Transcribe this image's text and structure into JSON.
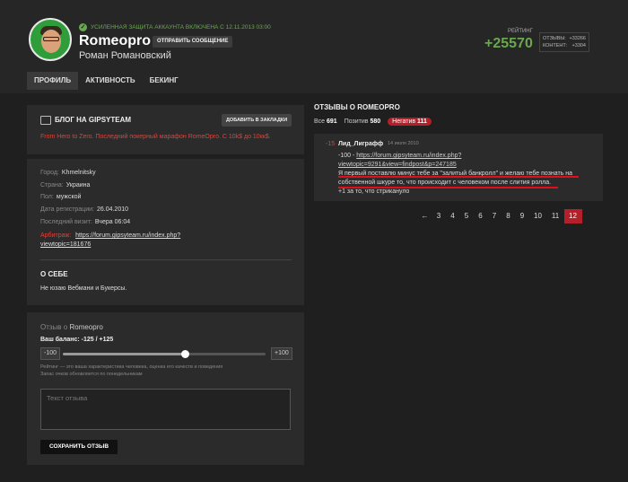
{
  "header": {
    "verify_text": "УСИЛЕННАЯ ЗАЩИТА АККАУНТА ВКЛЮЧЕНА С 12.11.2013 03:00",
    "nickname": "Romeopro",
    "send_message": "ОТПРАВИТЬ СООБЩЕНИЕ",
    "full_name": "Роман Романовский",
    "rating_label": "РЕЙТИНГ",
    "rating_value": "+25570",
    "reviews_label": "ОТЗЫВЫ:",
    "reviews_value": "+33266",
    "content_label": "КОНТЕНТ:",
    "content_value": "+3304"
  },
  "tabs": [
    {
      "label": "ПРОФИЛЬ",
      "active": true
    },
    {
      "label": "АКТИВНОСТЬ",
      "active": false
    },
    {
      "label": "БЕКИНГ",
      "active": false
    }
  ],
  "blog": {
    "title": "БЛОГ НА GIPSYTEAM",
    "bookmark": "ДОБАВИТЬ В ЗАКЛАДКИ",
    "description": "From Hero to Zero. Последний покерный марафон RomeOpro. С 10k$ до 10кк$."
  },
  "info": {
    "city_label": "Город:",
    "city": "Khmelnitsky",
    "country_label": "Страна:",
    "country": "Украина",
    "gender_label": "Пол:",
    "gender": "мужской",
    "reg_label": "Дата регистрации:",
    "reg": "26.04.2010",
    "visit_label": "Последний визит:",
    "visit": "Вчера 06:04",
    "backing_label": "Арбитраж:",
    "backing_link_1": "https://forum.gipsyteam.ru/index.php?",
    "backing_link_2": "viewtopic=181676"
  },
  "about": {
    "title": "О СЕБЕ",
    "text": "Не юзаю Вебмани и Букерсы."
  },
  "review_form": {
    "title_prefix": "Отзыв о",
    "title_name": "Romeopro",
    "balance": "Ваш баланс: -125 / +125",
    "min": "-100",
    "max": "+100",
    "level": 0.6,
    "hint_1": "Рейтинг — это ваша характеристика человека, оценка его качеств и поведения",
    "hint_2": "Запас очков обновляется по понедельникам",
    "placeholder": "Текст отзыва",
    "save": "СОХРАНИТЬ ОТЗЫВ"
  },
  "reviews": {
    "title": "ОТЗЫВЫ О ROMEOPRO",
    "all_label": "Все",
    "all_count": "691",
    "pos_label": "Позитив",
    "pos_count": "580",
    "neg_label": "Негатив",
    "neg_count": "111",
    "item": {
      "score": "-15",
      "author": "Лид_Лиграфф",
      "date": "14 июля 2010",
      "prefix": "-100 -",
      "link_1": "https://forum.gipsyteam.ru/index.php?",
      "link_2": "viewtopic=9291&view=findpost&p=247185",
      "line_1": "Я первый поставлю минус тебе за \"залитый банкролл\" и желаю тебе познать на",
      "line_2": "собственной шкуре то, что происходит с человеком после слития ролла.",
      "line_3": "+1 за то, что стриканулo"
    }
  },
  "pager": {
    "prev": "←",
    "pages": [
      "3",
      "4",
      "5",
      "6",
      "7",
      "8",
      "9",
      "10",
      "11",
      "12"
    ],
    "current": "12"
  },
  "colors": {
    "accent_green": "#6aa84f",
    "negative_red": "#b3202a",
    "link_red": "#e0423a"
  }
}
